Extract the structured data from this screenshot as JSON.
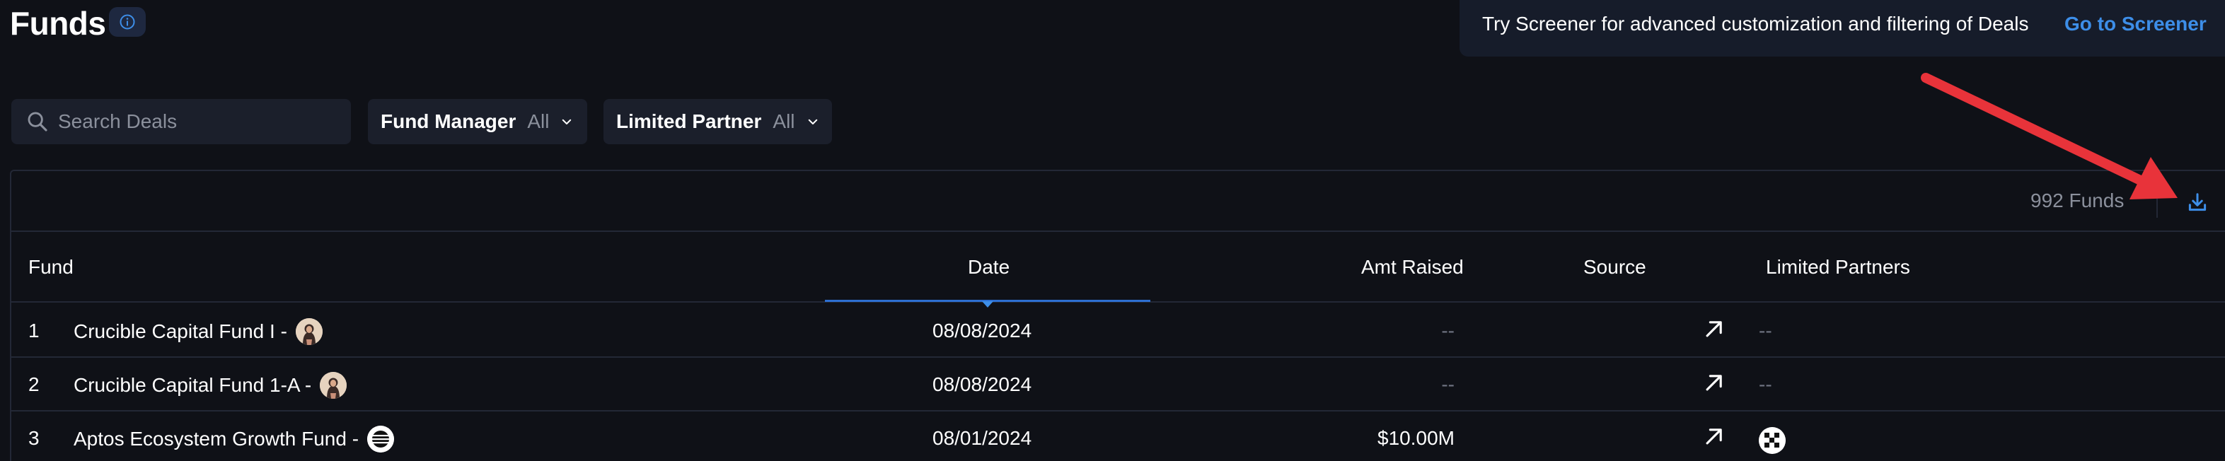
{
  "header": {
    "title": "Funds",
    "info_icon": "info-circle-icon"
  },
  "banner": {
    "text": "Try Screener for advanced customization and filtering of Deals",
    "link": "Go to Screener"
  },
  "filters": {
    "search_placeholder": "Search Deals",
    "fund_manager": {
      "label": "Fund Manager",
      "value": "All"
    },
    "limited_partner": {
      "label": "Limited Partner",
      "value": "All"
    }
  },
  "table": {
    "count_label": "992 Funds",
    "download_icon": "download-icon",
    "columns": [
      "Fund",
      "Date",
      "Amt Raised",
      "Source",
      "Limited Partners"
    ],
    "sorted_column": "Date",
    "rows": [
      {
        "index": "1",
        "fund": "Crucible Capital Fund I -",
        "avatar": "person-avatar",
        "date": "08/08/2024",
        "amt_raised": "--",
        "source_icon": "external-link-arrow-icon",
        "limited_partners": "--"
      },
      {
        "index": "2",
        "fund": "Crucible Capital Fund 1-A -",
        "avatar": "person-avatar",
        "date": "08/08/2024",
        "amt_raised": "--",
        "source_icon": "external-link-arrow-icon",
        "limited_partners": "--"
      },
      {
        "index": "3",
        "fund": "Aptos Ecosystem Growth Fund -",
        "avatar": "aptos-logo-avatar",
        "date": "08/01/2024",
        "amt_raised": "$10.00M",
        "source_icon": "external-link-arrow-icon",
        "limited_partners": ""
      }
    ]
  },
  "colors": {
    "background": "#0f1117",
    "surface": "#1b1f2b",
    "accent": "#3d8ee8",
    "annotation_arrow": "#e8333a",
    "muted_text": "#8b909c"
  }
}
